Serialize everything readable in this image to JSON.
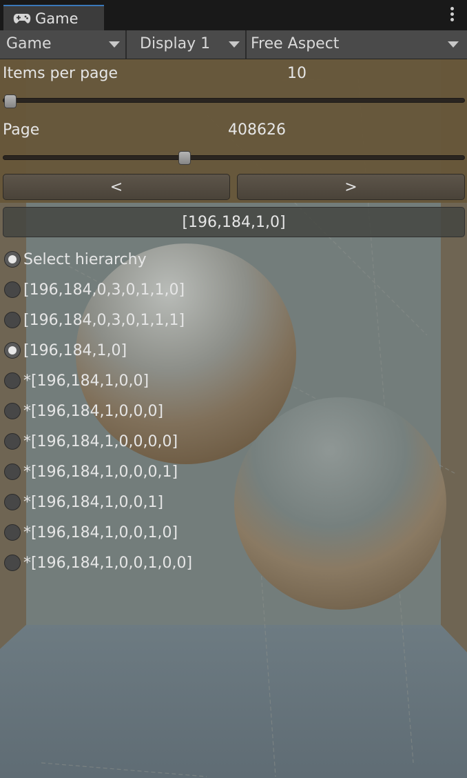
{
  "window": {
    "tab_label": "Game",
    "tab_icon": "gamepad-icon",
    "menu_icon": "kebab-menu-icon"
  },
  "toolbar": {
    "view_select": "Game",
    "display_select": "Display 1",
    "aspect_select": "Free Aspect"
  },
  "controls": {
    "items_per_page_label": "Items per page",
    "items_per_page_value": "10",
    "items_per_page_fraction": 0.0,
    "page_label": "Page",
    "page_value": "408626",
    "page_fraction": 0.39,
    "prev_label": "<",
    "next_label": ">",
    "current_path": "[196,184,1,0]"
  },
  "list": {
    "select_hierarchy_label": "Select hierarchy",
    "items": [
      {
        "label": "[196,184,0,3,0,1,1,0]",
        "checked": false
      },
      {
        "label": "[196,184,0,3,0,1,1,1]",
        "checked": false
      },
      {
        "label": "[196,184,1,0]",
        "checked": true
      },
      {
        "label": "*[196,184,1,0,0]",
        "checked": false
      },
      {
        "label": "*[196,184,1,0,0,0]",
        "checked": false
      },
      {
        "label": "*[196,184,1,0,0,0,0]",
        "checked": false
      },
      {
        "label": "*[196,184,1,0,0,0,1]",
        "checked": false
      },
      {
        "label": "*[196,184,1,0,0,1]",
        "checked": false
      },
      {
        "label": "*[196,184,1,0,0,1,0]",
        "checked": false
      },
      {
        "label": "*[196,184,1,0,0,1,0,0]",
        "checked": false
      }
    ]
  },
  "colors": {
    "accent": "#3a79bb",
    "panel_brown": "#665639",
    "background": "#737d7b"
  }
}
